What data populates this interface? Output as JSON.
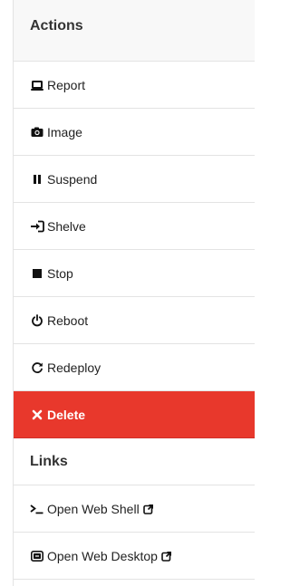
{
  "actions": {
    "title": "Actions",
    "items": [
      {
        "label": "Report",
        "icon": "report-icon"
      },
      {
        "label": "Image",
        "icon": "camera-icon"
      },
      {
        "label": "Suspend",
        "icon": "pause-icon"
      },
      {
        "label": "Shelve",
        "icon": "sign-in-icon"
      },
      {
        "label": "Stop",
        "icon": "stop-icon"
      },
      {
        "label": "Reboot",
        "icon": "power-icon"
      },
      {
        "label": "Redeploy",
        "icon": "refresh-icon"
      },
      {
        "label": "Delete",
        "icon": "x-icon"
      }
    ]
  },
  "links": {
    "title": "Links",
    "items": [
      {
        "label": "Open Web Shell",
        "icon": "terminal-icon"
      },
      {
        "label": "Open Web Desktop",
        "icon": "desktop-icon"
      }
    ]
  },
  "colors": {
    "danger": "#e8382c",
    "border": "#e3e3e3",
    "header_bg": "#f8f8f8"
  }
}
